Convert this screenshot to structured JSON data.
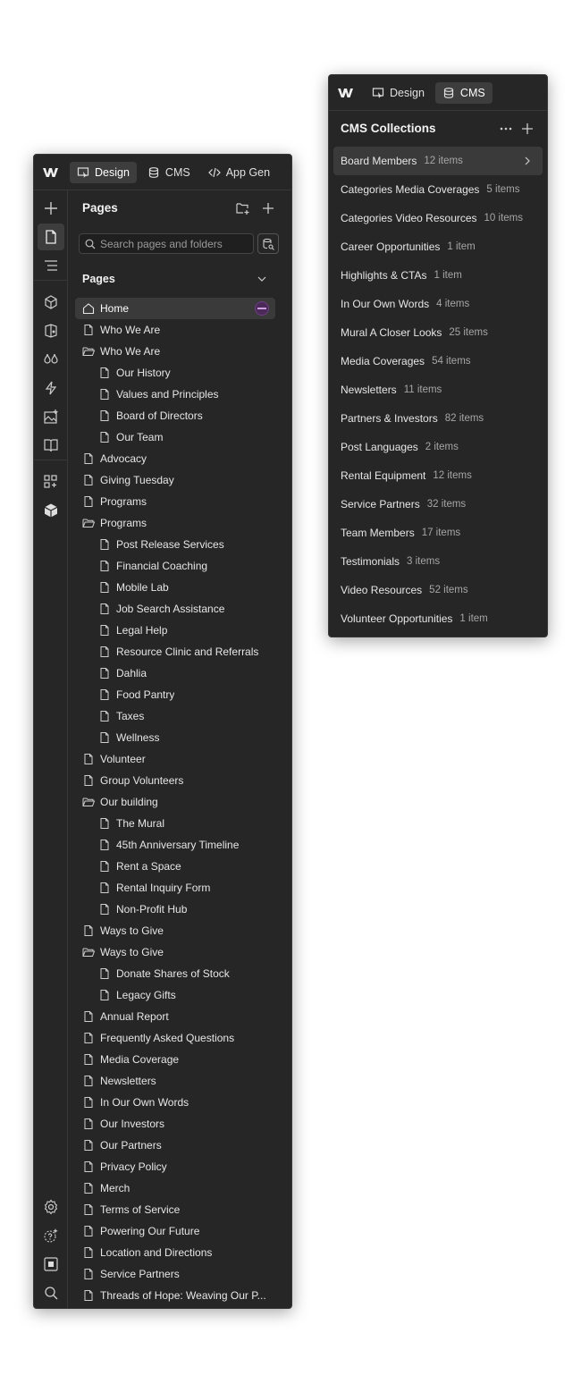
{
  "pages_panel": {
    "tabs": [
      {
        "label": "Design",
        "active": true
      },
      {
        "label": "CMS",
        "active": false
      },
      {
        "label": "App Gen",
        "active": false
      }
    ],
    "title": "Pages",
    "search_placeholder": "Search pages and folders",
    "section_title": "Pages",
    "rail_icons": [
      "add-icon",
      "pages-icon",
      "navigator-icon",
      "components-icon",
      "variables-icon",
      "styles-icon",
      "interactions-icon",
      "assets-icon",
      "library-icon",
      "apps-icon",
      "cms-box-icon",
      "settings-icon",
      "help-icon",
      "stop-icon",
      "search-icon",
      "publish-icon"
    ],
    "items": [
      {
        "label": "Home",
        "level": 0,
        "icon": "home-icon",
        "selected": true
      },
      {
        "label": "Who We Are",
        "level": 0,
        "icon": "page-icon"
      },
      {
        "label": "Who We Are",
        "level": 0,
        "icon": "folder-open-icon"
      },
      {
        "label": "Our History",
        "level": 1,
        "icon": "page-icon"
      },
      {
        "label": "Values and Principles",
        "level": 1,
        "icon": "page-icon"
      },
      {
        "label": "Board of Directors",
        "level": 1,
        "icon": "page-icon"
      },
      {
        "label": "Our Team",
        "level": 1,
        "icon": "page-icon"
      },
      {
        "label": "Advocacy",
        "level": 0,
        "icon": "page-icon"
      },
      {
        "label": "Giving Tuesday",
        "level": 0,
        "icon": "page-icon"
      },
      {
        "label": "Programs",
        "level": 0,
        "icon": "page-icon"
      },
      {
        "label": "Programs",
        "level": 0,
        "icon": "folder-open-icon"
      },
      {
        "label": "Post Release Services",
        "level": 1,
        "icon": "page-icon"
      },
      {
        "label": "Financial Coaching",
        "level": 1,
        "icon": "page-icon"
      },
      {
        "label": "Mobile Lab",
        "level": 1,
        "icon": "page-icon"
      },
      {
        "label": "Job Search Assistance",
        "level": 1,
        "icon": "page-icon"
      },
      {
        "label": "Legal Help",
        "level": 1,
        "icon": "page-icon"
      },
      {
        "label": "Resource Clinic and Referrals",
        "level": 1,
        "icon": "page-icon"
      },
      {
        "label": "Dahlia",
        "level": 1,
        "icon": "page-icon"
      },
      {
        "label": "Food Pantry",
        "level": 1,
        "icon": "page-icon"
      },
      {
        "label": "Taxes",
        "level": 1,
        "icon": "page-icon"
      },
      {
        "label": "Wellness",
        "level": 1,
        "icon": "page-icon"
      },
      {
        "label": "Volunteer",
        "level": 0,
        "icon": "page-icon"
      },
      {
        "label": "Group Volunteers",
        "level": 0,
        "icon": "page-icon"
      },
      {
        "label": "Our building",
        "level": 0,
        "icon": "folder-open-icon"
      },
      {
        "label": "The Mural",
        "level": 1,
        "icon": "page-icon"
      },
      {
        "label": "45th Anniversary Timeline",
        "level": 1,
        "icon": "page-icon"
      },
      {
        "label": "Rent a Space",
        "level": 1,
        "icon": "page-icon"
      },
      {
        "label": "Rental Inquiry Form",
        "level": 1,
        "icon": "page-icon"
      },
      {
        "label": "Non-Profit Hub",
        "level": 1,
        "icon": "page-icon"
      },
      {
        "label": "Ways to Give",
        "level": 0,
        "icon": "page-icon"
      },
      {
        "label": "Ways to Give",
        "level": 0,
        "icon": "folder-open-icon"
      },
      {
        "label": "Donate Shares of Stock",
        "level": 1,
        "icon": "page-icon"
      },
      {
        "label": "Legacy Gifts",
        "level": 1,
        "icon": "page-icon"
      },
      {
        "label": "Annual Report",
        "level": 0,
        "icon": "page-icon"
      },
      {
        "label": "Frequently Asked Questions",
        "level": 0,
        "icon": "page-icon"
      },
      {
        "label": "Media Coverage",
        "level": 0,
        "icon": "page-icon"
      },
      {
        "label": "Newsletters",
        "level": 0,
        "icon": "page-icon"
      },
      {
        "label": "In Our Own Words",
        "level": 0,
        "icon": "page-icon"
      },
      {
        "label": "Our Investors",
        "level": 0,
        "icon": "page-icon"
      },
      {
        "label": "Our Partners",
        "level": 0,
        "icon": "page-icon"
      },
      {
        "label": "Privacy Policy",
        "level": 0,
        "icon": "page-icon"
      },
      {
        "label": "Merch",
        "level": 0,
        "icon": "page-icon"
      },
      {
        "label": "Terms of Service",
        "level": 0,
        "icon": "page-icon"
      },
      {
        "label": "Powering Our Future",
        "level": 0,
        "icon": "page-icon"
      },
      {
        "label": "Location and Directions",
        "level": 0,
        "icon": "page-icon"
      },
      {
        "label": "Service Partners",
        "level": 0,
        "icon": "page-icon"
      },
      {
        "label": "Threads of Hope: Weaving Our P...",
        "level": 0,
        "icon": "page-icon"
      }
    ]
  },
  "cms_panel": {
    "tabs": [
      {
        "label": "Design",
        "active": false
      },
      {
        "label": "CMS",
        "active": true
      }
    ],
    "title": "CMS Collections",
    "collections": [
      {
        "name": "Board Members",
        "count": "12 items",
        "selected": true
      },
      {
        "name": "Categories Media Coverages",
        "count": "5 items"
      },
      {
        "name": "Categories Video Resources",
        "count": "10 items"
      },
      {
        "name": "Career Opportunities",
        "count": "1 item"
      },
      {
        "name": "Highlights & CTAs",
        "count": "1 item"
      },
      {
        "name": "In Our Own Words",
        "count": "4 items"
      },
      {
        "name": "Mural A Closer Looks",
        "count": "25 items"
      },
      {
        "name": "Media Coverages",
        "count": "54 items"
      },
      {
        "name": "Newsletters",
        "count": "11 items"
      },
      {
        "name": "Partners & Investors",
        "count": "82 items"
      },
      {
        "name": "Post Languages",
        "count": "2 items"
      },
      {
        "name": "Rental Equipment",
        "count": "12 items"
      },
      {
        "name": "Service Partners",
        "count": "32 items"
      },
      {
        "name": "Team Members",
        "count": "17 items"
      },
      {
        "name": "Testimonials",
        "count": "3 items"
      },
      {
        "name": "Video Resources",
        "count": "52 items"
      },
      {
        "name": "Volunteer Opportunities",
        "count": "1 item"
      }
    ]
  }
}
